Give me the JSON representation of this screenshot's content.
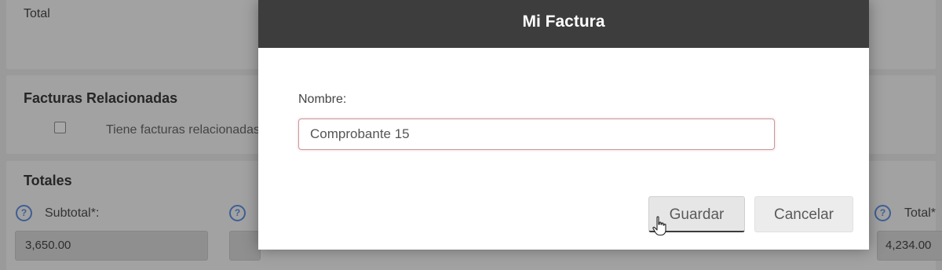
{
  "background_form": {
    "total_label": "Total",
    "related_invoices": {
      "heading": "Facturas Relacionadas",
      "checkbox_label": "Tiene facturas relacionadas",
      "checked": false
    },
    "totals": {
      "heading": "Totales",
      "help_icon_glyph": "?",
      "subtotal_label": "Subtotal*:",
      "subtotal_value": "3,650.00",
      "total_label": "Total*",
      "total_value": "4,234.00"
    }
  },
  "modal": {
    "title": "Mi Factura",
    "name_label": "Nombre:",
    "name_value": "Comprobante 15",
    "save_label": "Guardar",
    "cancel_label": "Cancelar"
  },
  "colors": {
    "modal_header_bg": "#3d3d3d",
    "help_icon": "#3e5f95",
    "input_focus_border": "#c79aa0"
  }
}
